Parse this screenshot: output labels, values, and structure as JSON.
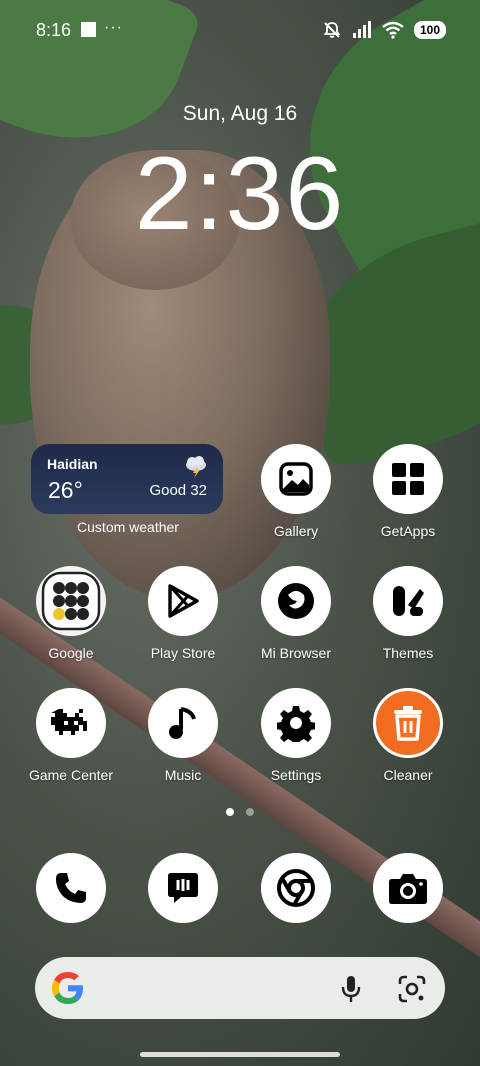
{
  "status_bar": {
    "time": "8:16",
    "dots": "···",
    "battery": "100"
  },
  "lockclock": {
    "date": "Sun, Aug 16",
    "time": "2:36"
  },
  "weather_widget": {
    "city": "Haidian",
    "temperature": "26°",
    "air_quality": "Good 32",
    "icon": "thunderstorm-icon",
    "label": "Custom weather"
  },
  "apps": {
    "gallery": "Gallery",
    "getapps": "GetApps",
    "google": "Google",
    "playstore": "Play Store",
    "mibrowser": "Mi Browser",
    "themes": "Themes",
    "gamecenter": "Game Center",
    "music": "Music",
    "settings": "Settings",
    "cleaner": "Cleaner"
  },
  "dock": [
    "phone-icon",
    "messages-icon",
    "chrome-icon",
    "camera-icon"
  ],
  "page_indicator": {
    "count": 2,
    "active": 1
  },
  "colors": {
    "cleaner_bg": "#f26d20",
    "search_bg": "#e9ece9"
  }
}
